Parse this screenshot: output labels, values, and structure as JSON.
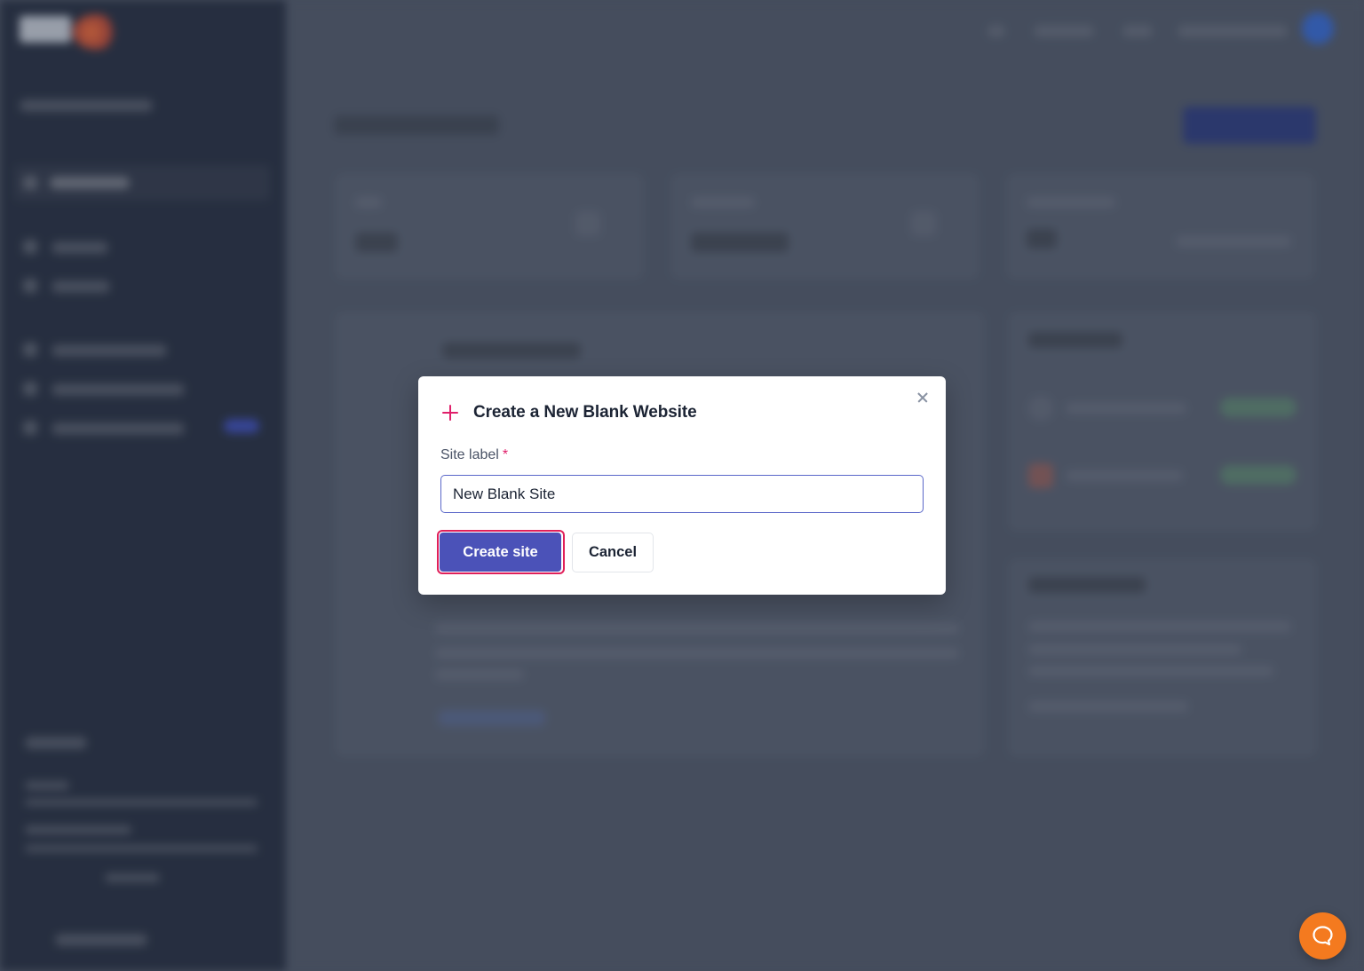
{
  "modal": {
    "title": "Create a New Blank Website",
    "icon": "plus-icon",
    "close_icon": "close-icon",
    "field": {
      "label": "Site label",
      "required_marker": "*",
      "value": "New Blank Site",
      "placeholder": ""
    },
    "buttons": {
      "create": "Create site",
      "cancel": "Cancel"
    }
  },
  "colors": {
    "accent": "#4b52b8",
    "required": "#e0206b",
    "focus_ring": "#e0205a",
    "chat": "#f47a1f",
    "sidebar": "#1b2336"
  },
  "chat_launcher": {
    "icon": "chat-bubble-icon"
  }
}
